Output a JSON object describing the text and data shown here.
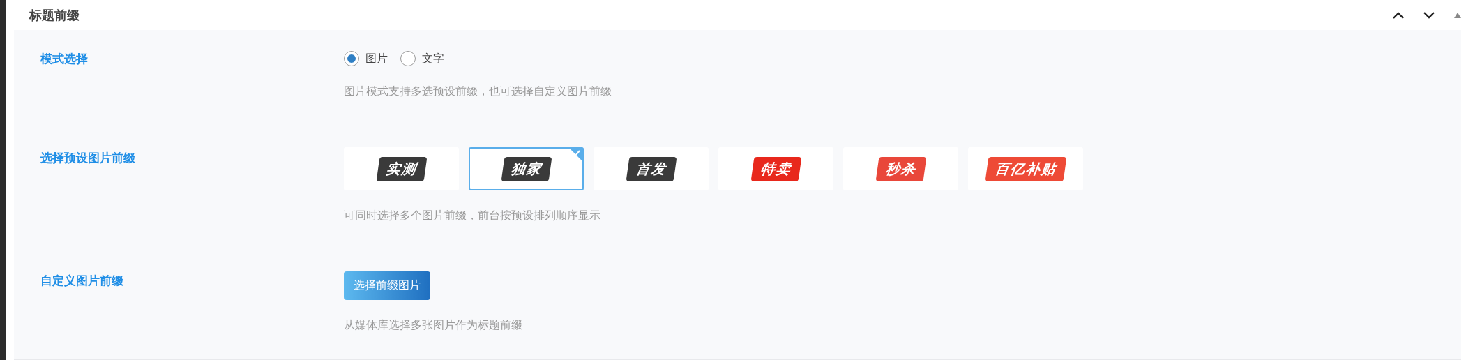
{
  "panel": {
    "title": "标题前缀"
  },
  "rows": [
    {
      "kind": "radio",
      "label": "模式选择",
      "options": [
        {
          "label": "图片",
          "selected": true
        },
        {
          "label": "文字",
          "selected": false
        }
      ],
      "hint": "图片模式支持多选预设前缀，也可选择自定义图片前缀"
    },
    {
      "kind": "tiles",
      "label": "选择预设图片前缀",
      "tiles": [
        {
          "label": "实测",
          "selected": false,
          "color": "#3a3a3a"
        },
        {
          "label": "独家",
          "selected": true,
          "color": "#3a3a3a"
        },
        {
          "label": "首发",
          "selected": false,
          "color": "#3a3a3a"
        },
        {
          "label": "特卖",
          "selected": false,
          "color": "#e8281c"
        },
        {
          "label": "秒杀",
          "selected": false,
          "color": "#e9473a"
        },
        {
          "label": "百亿补贴",
          "selected": false,
          "color": "#ee4a36"
        }
      ],
      "hint": "可同时选择多个图片前缀，前台按预设排列顺序显示"
    },
    {
      "kind": "button",
      "label": "自定义图片前缀",
      "button": "选择前缀图片",
      "hint": "从媒体库选择多张图片作为标题前缀"
    }
  ]
}
